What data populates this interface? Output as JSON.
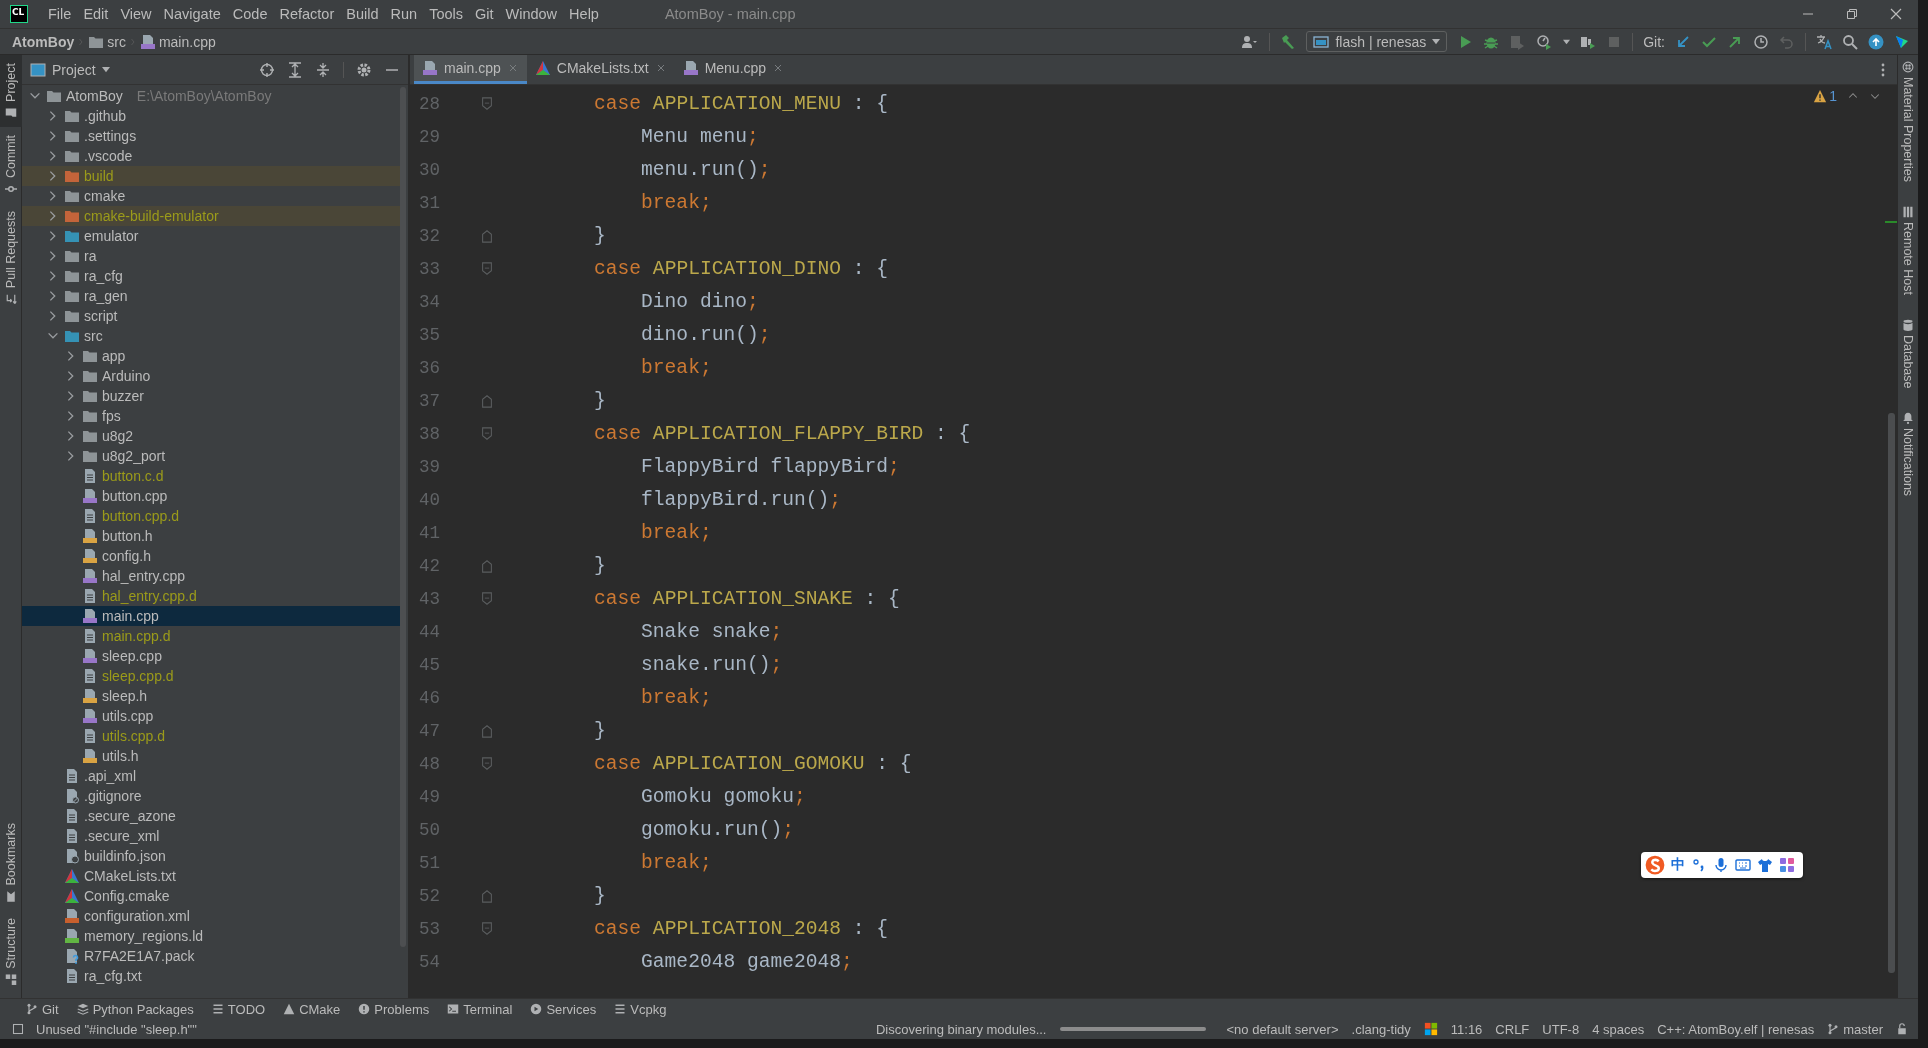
{
  "window": {
    "logo": "CL",
    "menu": [
      "File",
      "Edit",
      "View",
      "Navigate",
      "Code",
      "Refactor",
      "Build",
      "Run",
      "Tools",
      "Git",
      "Window",
      "Help"
    ],
    "title": "AtomBoy - main.cpp"
  },
  "breadcrumb": [
    {
      "label": "AtomBoy",
      "kind": "project"
    },
    {
      "label": "src",
      "kind": "folder"
    },
    {
      "label": "main.cpp",
      "kind": "file_cpp"
    }
  ],
  "toolbar": {
    "run_config": "flash | renesas",
    "vcs_label": "Git:"
  },
  "left_strip": {
    "top": [
      {
        "label": "Project",
        "selected": true
      },
      {
        "label": "Commit",
        "selected": false
      },
      {
        "label": "Pull Requests",
        "selected": false
      }
    ],
    "bottom": [
      {
        "label": "Bookmarks",
        "selected": false
      },
      {
        "label": "Structure",
        "selected": false
      }
    ]
  },
  "project_panel": {
    "title": "Project",
    "tree": [
      {
        "name": "AtomBoy",
        "path": "E:\\AtomBoy\\AtomBoy",
        "kind": "folder",
        "expanded": true,
        "selected": false,
        "ignored": false,
        "children": [
          {
            "name": ".github",
            "kind": "folder",
            "expanded": false,
            "selected": false,
            "ignored": false
          },
          {
            "name": ".settings",
            "kind": "folder",
            "expanded": false,
            "selected": false,
            "ignored": false
          },
          {
            "name": ".vscode",
            "kind": "folder",
            "expanded": false,
            "selected": false,
            "ignored": false
          },
          {
            "name": "build",
            "kind": "folder_excluded",
            "expanded": false,
            "selected": false,
            "ignored": true
          },
          {
            "name": "cmake",
            "kind": "folder",
            "expanded": false,
            "selected": false,
            "ignored": false
          },
          {
            "name": "cmake-build-emulator",
            "kind": "folder_excluded",
            "expanded": false,
            "selected": false,
            "ignored": true
          },
          {
            "name": "emulator",
            "kind": "folder_source",
            "expanded": false,
            "selected": false,
            "ignored": false
          },
          {
            "name": "ra",
            "kind": "folder",
            "expanded": false,
            "selected": false,
            "ignored": false
          },
          {
            "name": "ra_cfg",
            "kind": "folder",
            "expanded": false,
            "selected": false,
            "ignored": false
          },
          {
            "name": "ra_gen",
            "kind": "folder",
            "expanded": false,
            "selected": false,
            "ignored": false
          },
          {
            "name": "script",
            "kind": "folder",
            "expanded": false,
            "selected": false,
            "ignored": false
          },
          {
            "name": "src",
            "kind": "folder_source",
            "expanded": true,
            "selected": false,
            "ignored": false,
            "children": [
              {
                "name": "app",
                "kind": "folder",
                "expanded": false,
                "selected": false,
                "ignored": false
              },
              {
                "name": "Arduino",
                "kind": "folder",
                "expanded": false,
                "selected": false,
                "ignored": false
              },
              {
                "name": "buzzer",
                "kind": "folder",
                "expanded": false,
                "selected": false,
                "ignored": false
              },
              {
                "name": "fps",
                "kind": "folder",
                "expanded": false,
                "selected": false,
                "ignored": false
              },
              {
                "name": "u8g2",
                "kind": "folder",
                "expanded": false,
                "selected": false,
                "ignored": false
              },
              {
                "name": "u8g2_port",
                "kind": "folder",
                "expanded": false,
                "selected": false,
                "ignored": false
              },
              {
                "name": "button.c.d",
                "kind": "file_text",
                "selected": false,
                "ignored": true
              },
              {
                "name": "button.cpp",
                "kind": "file_cpp",
                "selected": false,
                "ignored": false
              },
              {
                "name": "button.cpp.d",
                "kind": "file_text",
                "selected": false,
                "ignored": true
              },
              {
                "name": "button.h",
                "kind": "file_h",
                "selected": false,
                "ignored": false
              },
              {
                "name": "config.h",
                "kind": "file_h",
                "selected": false,
                "ignored": false
              },
              {
                "name": "hal_entry.cpp",
                "kind": "file_cpp",
                "selected": false,
                "ignored": false
              },
              {
                "name": "hal_entry.cpp.d",
                "kind": "file_text",
                "selected": false,
                "ignored": true
              },
              {
                "name": "main.cpp",
                "kind": "file_cpp",
                "selected": true,
                "ignored": false
              },
              {
                "name": "main.cpp.d",
                "kind": "file_text",
                "selected": false,
                "ignored": true
              },
              {
                "name": "sleep.cpp",
                "kind": "file_cpp",
                "selected": false,
                "ignored": false
              },
              {
                "name": "sleep.cpp.d",
                "kind": "file_text",
                "selected": false,
                "ignored": true
              },
              {
                "name": "sleep.h",
                "kind": "file_h",
                "selected": false,
                "ignored": false
              },
              {
                "name": "utils.cpp",
                "kind": "file_cpp",
                "selected": false,
                "ignored": false
              },
              {
                "name": "utils.cpp.d",
                "kind": "file_text",
                "selected": false,
                "ignored": true
              },
              {
                "name": "utils.h",
                "kind": "file_h",
                "selected": false,
                "ignored": false
              }
            ]
          },
          {
            "name": ".api_xml",
            "kind": "file_text",
            "selected": false,
            "ignored": false
          },
          {
            "name": ".gitignore",
            "kind": "file_ignore",
            "selected": false,
            "ignored": false
          },
          {
            "name": ".secure_azone",
            "kind": "file_text",
            "selected": false,
            "ignored": false
          },
          {
            "name": ".secure_xml",
            "kind": "file_text",
            "selected": false,
            "ignored": false
          },
          {
            "name": "buildinfo.json",
            "kind": "file_json",
            "selected": false,
            "ignored": false
          },
          {
            "name": "CMakeLists.txt",
            "kind": "cmake",
            "selected": false,
            "ignored": false
          },
          {
            "name": "Config.cmake",
            "kind": "cmake",
            "selected": false,
            "ignored": false
          },
          {
            "name": "configuration.xml",
            "kind": "file_xml",
            "selected": false,
            "ignored": false
          },
          {
            "name": "memory_regions.ld",
            "kind": "file_ld",
            "selected": false,
            "ignored": false
          },
          {
            "name": "R7FA2E1A7.pack",
            "kind": "file_unknown",
            "selected": false,
            "ignored": false
          },
          {
            "name": "ra_cfg.txt",
            "kind": "file_text",
            "selected": false,
            "ignored": false
          }
        ]
      }
    ]
  },
  "tabs": [
    {
      "label": "main.cpp",
      "kind": "file_cpp",
      "selected": true
    },
    {
      "label": "CMakeLists.txt",
      "kind": "cmake",
      "selected": false
    },
    {
      "label": "Menu.cpp",
      "kind": "file_cpp",
      "selected": false
    }
  ],
  "editor": {
    "warnings": "1",
    "lines": [
      {
        "number": "28",
        "kind": "fold_start",
        "tokens": [
          {
            "kind": "keyword",
            "text": "        case"
          },
          {
            "kind": "constant",
            "text": " APPLICATION_MENU"
          },
          {
            "kind": "plain",
            "text": " : {"
          }
        ]
      },
      {
        "number": "29",
        "kind": "code",
        "tokens": [
          {
            "kind": "plain",
            "text": "            Menu menu"
          },
          {
            "kind": "semicolon",
            "text": ";"
          }
        ]
      },
      {
        "number": "30",
        "kind": "code",
        "tokens": [
          {
            "kind": "plain",
            "text": "            menu.run()"
          },
          {
            "kind": "semicolon",
            "text": ";"
          }
        ]
      },
      {
        "number": "31",
        "kind": "code",
        "tokens": [
          {
            "kind": "keyword",
            "text": "            break"
          },
          {
            "kind": "semicolon",
            "text": ";"
          }
        ]
      },
      {
        "number": "32",
        "kind": "fold_end",
        "tokens": [
          {
            "kind": "plain",
            "text": "        }"
          }
        ]
      },
      {
        "number": "33",
        "kind": "fold_start",
        "tokens": [
          {
            "kind": "keyword",
            "text": "        case"
          },
          {
            "kind": "constant",
            "text": " APPLICATION_DINO"
          },
          {
            "kind": "plain",
            "text": " : {"
          }
        ]
      },
      {
        "number": "34",
        "kind": "code",
        "tokens": [
          {
            "kind": "plain",
            "text": "            Dino dino"
          },
          {
            "kind": "semicolon",
            "text": ";"
          }
        ]
      },
      {
        "number": "35",
        "kind": "code",
        "tokens": [
          {
            "kind": "plain",
            "text": "            dino.run()"
          },
          {
            "kind": "semicolon",
            "text": ";"
          }
        ]
      },
      {
        "number": "36",
        "kind": "code",
        "tokens": [
          {
            "kind": "keyword",
            "text": "            break"
          },
          {
            "kind": "semicolon",
            "text": ";"
          }
        ]
      },
      {
        "number": "37",
        "kind": "fold_end",
        "tokens": [
          {
            "kind": "plain",
            "text": "        }"
          }
        ]
      },
      {
        "number": "38",
        "kind": "fold_start",
        "tokens": [
          {
            "kind": "keyword",
            "text": "        case"
          },
          {
            "kind": "constant",
            "text": " APPLICATION_FLAPPY_BIRD"
          },
          {
            "kind": "plain",
            "text": " : {"
          }
        ]
      },
      {
        "number": "39",
        "kind": "code",
        "tokens": [
          {
            "kind": "plain",
            "text": "            FlappyBird flappyBird"
          },
          {
            "kind": "semicolon",
            "text": ";"
          }
        ]
      },
      {
        "number": "40",
        "kind": "code",
        "tokens": [
          {
            "kind": "plain",
            "text": "            flappyBird.run()"
          },
          {
            "kind": "semicolon",
            "text": ";"
          }
        ]
      },
      {
        "number": "41",
        "kind": "code",
        "tokens": [
          {
            "kind": "keyword",
            "text": "            break"
          },
          {
            "kind": "semicolon",
            "text": ";"
          }
        ]
      },
      {
        "number": "42",
        "kind": "fold_end",
        "tokens": [
          {
            "kind": "plain",
            "text": "        }"
          }
        ]
      },
      {
        "number": "43",
        "kind": "fold_start",
        "tokens": [
          {
            "kind": "keyword",
            "text": "        case"
          },
          {
            "kind": "constant",
            "text": " APPLICATION_SNAKE"
          },
          {
            "kind": "plain",
            "text": " : {"
          }
        ]
      },
      {
        "number": "44",
        "kind": "code",
        "tokens": [
          {
            "kind": "plain",
            "text": "            Snake snake"
          },
          {
            "kind": "semicolon",
            "text": ";"
          }
        ]
      },
      {
        "number": "45",
        "kind": "code",
        "tokens": [
          {
            "kind": "plain",
            "text": "            snake.run()"
          },
          {
            "kind": "semicolon",
            "text": ";"
          }
        ]
      },
      {
        "number": "46",
        "kind": "code",
        "tokens": [
          {
            "kind": "keyword",
            "text": "            break"
          },
          {
            "kind": "semicolon",
            "text": ";"
          }
        ]
      },
      {
        "number": "47",
        "kind": "fold_end",
        "tokens": [
          {
            "kind": "plain",
            "text": "        }"
          }
        ]
      },
      {
        "number": "48",
        "kind": "fold_start",
        "tokens": [
          {
            "kind": "keyword",
            "text": "        case"
          },
          {
            "kind": "constant",
            "text": " APPLICATION_GOMOKU"
          },
          {
            "kind": "plain",
            "text": " : {"
          }
        ]
      },
      {
        "number": "49",
        "kind": "code",
        "tokens": [
          {
            "kind": "plain",
            "text": "            Gomoku gomoku"
          },
          {
            "kind": "semicolon",
            "text": ";"
          }
        ]
      },
      {
        "number": "50",
        "kind": "code",
        "tokens": [
          {
            "kind": "plain",
            "text": "            gomoku.run()"
          },
          {
            "kind": "semicolon",
            "text": ";"
          }
        ]
      },
      {
        "number": "51",
        "kind": "code",
        "tokens": [
          {
            "kind": "keyword",
            "text": "            break"
          },
          {
            "kind": "semicolon",
            "text": ";"
          }
        ]
      },
      {
        "number": "52",
        "kind": "fold_end",
        "tokens": [
          {
            "kind": "plain",
            "text": "        }"
          }
        ]
      },
      {
        "number": "53",
        "kind": "fold_start",
        "tokens": [
          {
            "kind": "keyword",
            "text": "        case"
          },
          {
            "kind": "constant",
            "text": " APPLICATION_2048"
          },
          {
            "kind": "plain",
            "text": " : {"
          }
        ]
      },
      {
        "number": "54",
        "kind": "code",
        "tokens": [
          {
            "kind": "plain",
            "text": "            Game2048 game2048"
          },
          {
            "kind": "semicolon",
            "text": ";"
          }
        ]
      }
    ]
  },
  "ime_bar": {
    "label": "中"
  },
  "right_strip": [
    {
      "label": "Material Properties",
      "kind": "ball"
    },
    {
      "label": "Remote Host",
      "kind": "server"
    },
    {
      "label": "Database",
      "kind": "database"
    },
    {
      "label": "Notifications",
      "kind": "bell"
    }
  ],
  "tool_windows": [
    {
      "label": "Git",
      "kind": "branch"
    },
    {
      "label": "Python Packages",
      "kind": "packages"
    },
    {
      "label": "TODO",
      "kind": "list"
    },
    {
      "label": "CMake",
      "kind": "triangle"
    },
    {
      "label": "Problems",
      "kind": "info"
    },
    {
      "label": "Terminal",
      "kind": "terminal"
    },
    {
      "label": "Services",
      "kind": "services"
    },
    {
      "label": "Vcpkg",
      "kind": "list"
    }
  ],
  "status_bar": {
    "message": "Unused \"#include \"sleep.h\"\"",
    "task": "Discovering binary modules...",
    "items": [
      {
        "kind": "text",
        "label": "<no default server>"
      },
      {
        "kind": "text",
        "label": ".clang-tidy"
      },
      {
        "kind": "logo"
      },
      {
        "kind": "text",
        "label": "11:16"
      },
      {
        "kind": "text",
        "label": "CRLF"
      },
      {
        "kind": "text",
        "label": "UTF-8"
      },
      {
        "kind": "text",
        "label": "4 spaces"
      },
      {
        "kind": "text",
        "label": "C++: AtomBoy.elf | renesas"
      },
      {
        "kind": "branch",
        "label": "master"
      },
      {
        "kind": "lock"
      }
    ]
  }
}
